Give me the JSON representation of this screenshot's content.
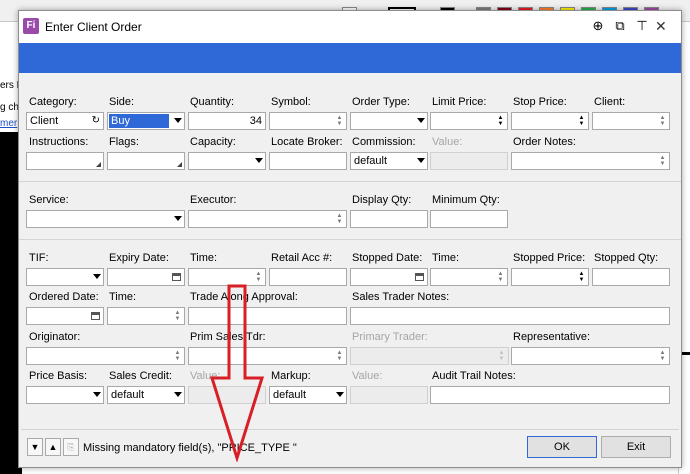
{
  "background": {
    "left_fragments": [
      "ers F",
      "g ch",
      "mer"
    ]
  },
  "dialog": {
    "title": "Enter Client Order",
    "icons": [
      "pin-icon",
      "restore-icon",
      "dock-icon",
      "close-icon"
    ]
  },
  "form": {
    "row1": {
      "category_label": "Category:",
      "category_value": "Client",
      "side_label": "Side:",
      "side_value": "Buy",
      "quantity_label": "Quantity:",
      "quantity_value": "34",
      "symbol_label": "Symbol:",
      "order_type_label": "Order Type:",
      "limit_price_label": "Limit Price:",
      "stop_price_label": "Stop Price:",
      "client_label": "Client:"
    },
    "row2": {
      "instructions_label": "Instructions:",
      "flags_label": "Flags:",
      "capacity_label": "Capacity:",
      "locate_broker_label": "Locate Broker:",
      "commission_label": "Commission:",
      "commission_value": "default",
      "value_label": "Value:",
      "order_notes_label": "Order Notes:"
    },
    "row3": {
      "service_label": "Service:",
      "executor_label": "Executor:",
      "display_qty_label": "Display Qty:",
      "minimum_qty_label": "Minimum Qty:"
    },
    "row4": {
      "tif_label": "TIF:",
      "expiry_date_label": "Expiry Date:",
      "time_label": "Time:",
      "retail_acc_label": "Retail Acc #:",
      "stopped_date_label": "Stopped Date:",
      "time2_label": "Time:",
      "stopped_price_label": "Stopped Price:",
      "stopped_qty_label": "Stopped Qty:"
    },
    "row5": {
      "ordered_date_label": "Ordered Date:",
      "time_label": "Time:",
      "trade_along_label": "Trade Along Approval:",
      "sales_trader_notes_label": "Sales Trader Notes:"
    },
    "row6": {
      "originator_label": "Originator:",
      "prim_sales_tdr_label": "Prim Sales Tdr:",
      "primary_trader_label": "Primary Trader:",
      "representative_label": "Representative:"
    },
    "row7": {
      "price_basis_label": "Price Basis:",
      "sales_credit_label": "Sales Credit:",
      "sales_credit_value": "default",
      "value_label": "Value:",
      "markup_label": "Markup:",
      "markup_value": "default",
      "value2_label": "Value:",
      "audit_trail_label": "Audit Trail Notes:"
    }
  },
  "statusbar": {
    "message": "Missing mandatory field(s), \"PRICE_TYPE \"",
    "ok_label": "OK",
    "exit_label": "Exit"
  },
  "colors": {
    "accent_blue": "#2f69d8",
    "annotation_red": "#d81f26"
  }
}
